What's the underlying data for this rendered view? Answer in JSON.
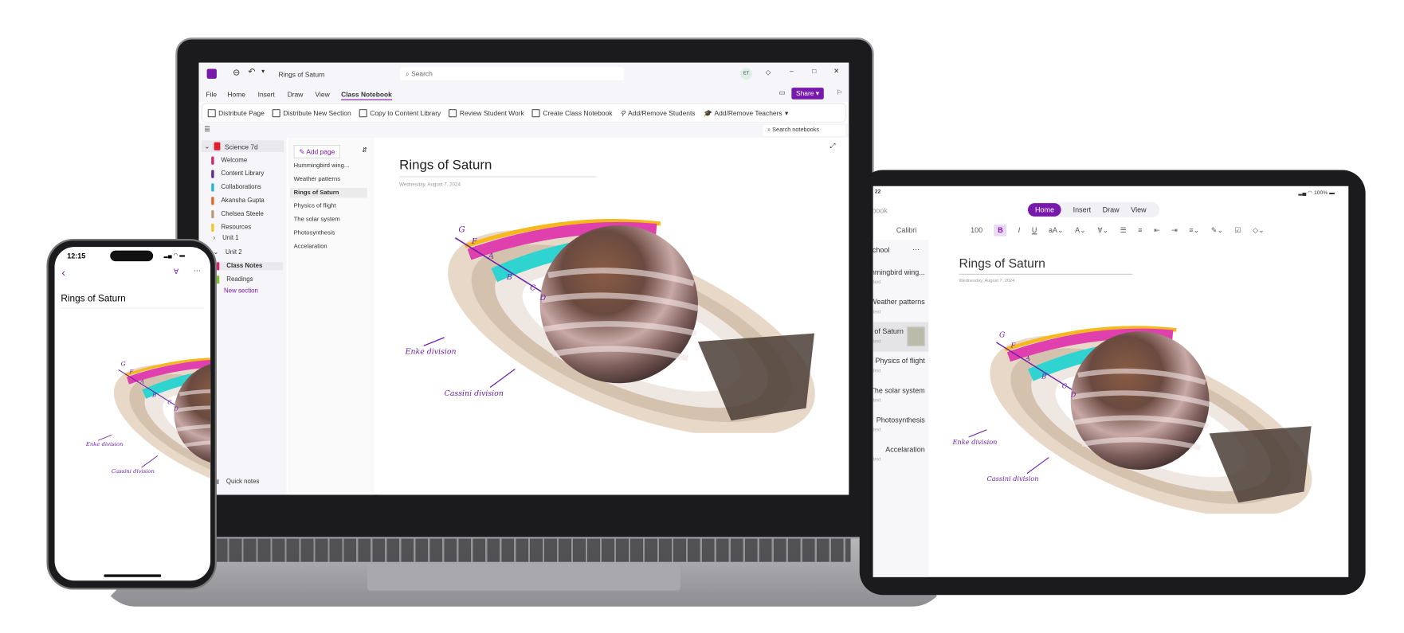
{
  "colors": {
    "accent": "#7719aa",
    "pink": "#e03fae",
    "cyan": "#2fd3cf",
    "yellow": "#f6b81c"
  },
  "laptop": {
    "title": "Rings of Saturn",
    "search_placeholder": "Search",
    "avatar": "ET",
    "share": "Share",
    "menu": [
      "File",
      "Home",
      "Insert",
      "Draw",
      "View",
      "Class Notebook"
    ],
    "ribbon": [
      "Distribute Page",
      "Distribute New Section",
      "Copy to Content Library",
      "Review Student Work",
      "Create Class Notebook",
      "Add/Remove Students",
      "Add/Remove Teachers"
    ],
    "search_notebooks": "Search notebooks",
    "notebook": "Science 7d",
    "sections": [
      {
        "label": "Welcome",
        "color": "#d6246e"
      },
      {
        "label": "Content Library",
        "color": "#5b2a9a"
      },
      {
        "label": "Collaborations",
        "color": "#1fb3d9"
      },
      {
        "label": "Akansha Gupta",
        "color": "#e2672a"
      },
      {
        "label": "Chelsea Steele",
        "color": "#b89a7a"
      },
      {
        "label": "Resources",
        "color": "#f2c624"
      }
    ],
    "groups": [
      "Unit 1",
      "Unit 2"
    ],
    "unit2_sections": [
      {
        "label": "Class Notes",
        "color": "#d6246e"
      },
      {
        "label": "Readings",
        "color": "#7cc22b"
      }
    ],
    "new_section": "New section",
    "quick_notes": "Quick notes",
    "add_page": "Add page",
    "pages": [
      "Hummingbird wing...",
      "Weather patterns",
      "Rings of Saturn",
      "Physics of flight",
      "The solar system",
      "Photosynthesis",
      "Accelaration"
    ],
    "page_title": "Rings of Saturn",
    "page_date": "Wednesday, August 7, 2024"
  },
  "diagram": {
    "labels": [
      "G",
      "F",
      "A",
      "B",
      "C",
      "D"
    ],
    "enke": "Enke division",
    "cassini": "Cassini division"
  },
  "tablet": {
    "time": "22",
    "battery": "100%",
    "notebook": "Notebook",
    "tabs": [
      "Home",
      "Insert",
      "Draw",
      "View"
    ],
    "font": "Calibri",
    "size": "100",
    "section": "School",
    "pages": [
      {
        "title": "Hummingbird wing...",
        "sub": "text"
      },
      {
        "title": "Weather patterns",
        "sub": "text"
      },
      {
        "title": "Rings of Saturn",
        "sub": "text"
      },
      {
        "title": "Physics of flight",
        "sub": "text"
      },
      {
        "title": "The solar system",
        "sub": "text"
      },
      {
        "title": "Photosynthesis",
        "sub": "text"
      },
      {
        "title": "Accelaration",
        "sub": "text"
      }
    ],
    "page_title": "Rings of Saturn",
    "page_date": "Wednesday, August 7, 2024"
  },
  "phone": {
    "time": "12:15",
    "page_title": "Rings of Saturn"
  }
}
